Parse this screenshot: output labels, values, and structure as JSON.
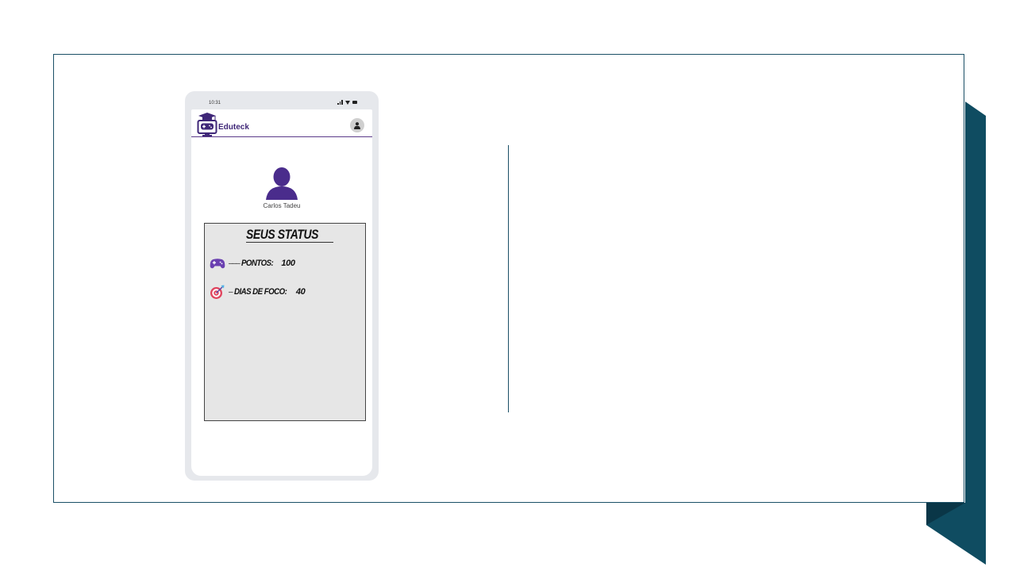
{
  "status_bar": {
    "time": "10:31"
  },
  "app": {
    "title": "Eduteck"
  },
  "profile": {
    "name": "Carlos Tadeu"
  },
  "status_card": {
    "title": "SEUS STATUS",
    "items": [
      {
        "label": "PONTOS:",
        "value": "100",
        "icon": "gamepad-icon"
      },
      {
        "label": "DIAS DE FOCO:",
        "value": "40",
        "icon": "target-icon"
      }
    ]
  },
  "colors": {
    "brand_purple": "#3f2778",
    "accent_teal": "#0f4c61",
    "card_background": "#e6e6e6"
  }
}
